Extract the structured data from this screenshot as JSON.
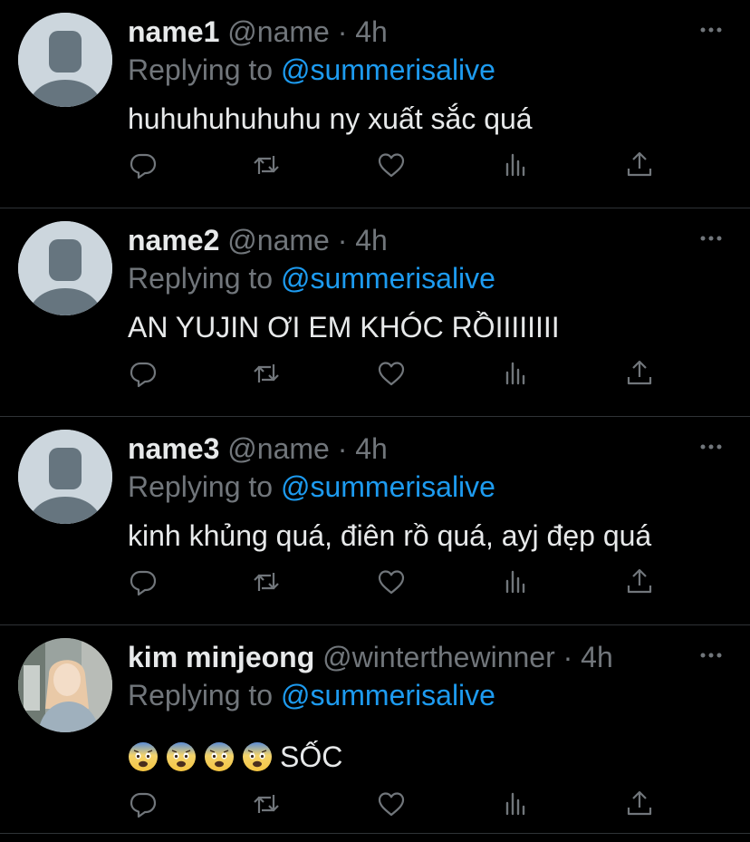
{
  "colors": {
    "background": "#000000",
    "name": "#e7e9ea",
    "muted": "#71767b",
    "mention": "#1d9bf0",
    "divider": "#2f3336"
  },
  "tweets": [
    {
      "name": "name1",
      "handle": "@name",
      "separator": "·",
      "time": "4h",
      "replying_prefix": "Replying to",
      "replying_to": "@summerisalive",
      "text": "huhuhuhuhuhu ny xuất sắc quá",
      "avatar": "default-avatar"
    },
    {
      "name": "name2",
      "handle": "@name",
      "separator": "·",
      "time": "4h",
      "replying_prefix": "Replying to",
      "replying_to": "@summerisalive",
      "text": "AN YUJIN ƠI EM KHÓC RỒIIIIIIII",
      "avatar": "default-avatar"
    },
    {
      "name": "name3",
      "handle": "@name",
      "separator": "·",
      "time": "4h",
      "replying_prefix": "Replying to",
      "replying_to": "@summerisalive",
      "text": "kinh khủng quá, điên rồ quá, ayj đẹp quá",
      "avatar": "default-avatar"
    },
    {
      "name": "kim minjeong",
      "handle": "@winterthewinner",
      "separator": "·",
      "time": "4h",
      "replying_prefix": "Replying to",
      "replying_to": "@summerisalive",
      "text": "SỐC",
      "emojis": [
        "fearful-face",
        "fearful-face",
        "fearful-face",
        "fearful-face"
      ],
      "avatar": "photo-avatar"
    }
  ],
  "action_icons": [
    "reply-icon",
    "retweet-icon",
    "like-icon",
    "analytics-icon",
    "share-icon"
  ]
}
